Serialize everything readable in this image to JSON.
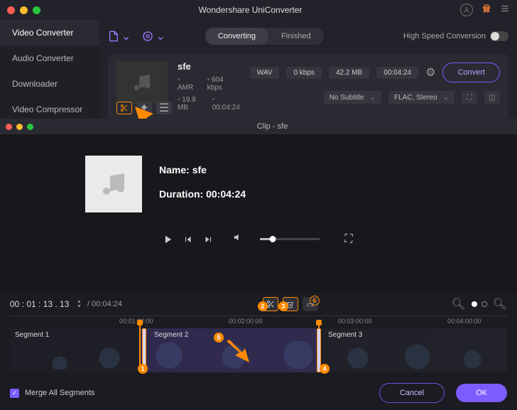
{
  "title": "Wondershare UniConverter",
  "sidebar": {
    "items": [
      {
        "label": "Video Converter"
      },
      {
        "label": "Audio Converter"
      },
      {
        "label": "Downloader"
      },
      {
        "label": "Video Compressor"
      }
    ]
  },
  "tabs": {
    "converting": "Converting",
    "finished": "Finished"
  },
  "hispeed_label": "High Speed Conversion",
  "file": {
    "name": "sfe",
    "codec": "AMR",
    "bitrate": "604 kbps",
    "size": "19.9 MB",
    "duration": "00:04:24",
    "out_format": "WAV",
    "out_bitrate": "0 kbps",
    "out_size": "42.2 MB",
    "out_duration": "00:04:24",
    "subtitle": "No Subtitle",
    "audio_profile": "FLAC, Stereo",
    "convert_label": "Convert"
  },
  "clip": {
    "titlebar": "Clip - sfe",
    "name_label": "Name: ",
    "name_value": "sfe",
    "duration_label": "Duration: ",
    "duration_value": "00:04:24"
  },
  "timeline": {
    "timecode": "00 : 01 : 13 . 13",
    "total": "/ 00:04:24",
    "ruler": [
      "00:01:00:00",
      "00:02:00:00",
      "00:03:00:00",
      "00:04:00:00"
    ],
    "segments": [
      "Segment 1",
      "Segment 2",
      "Segment 3"
    ]
  },
  "footer": {
    "merge": "Merge All Segments",
    "cancel": "Cancel",
    "ok": "OK"
  },
  "callouts": {
    "c1": "1",
    "c2": "2",
    "c3": "3",
    "c4": "4",
    "c5": "5",
    "c6": "6"
  }
}
